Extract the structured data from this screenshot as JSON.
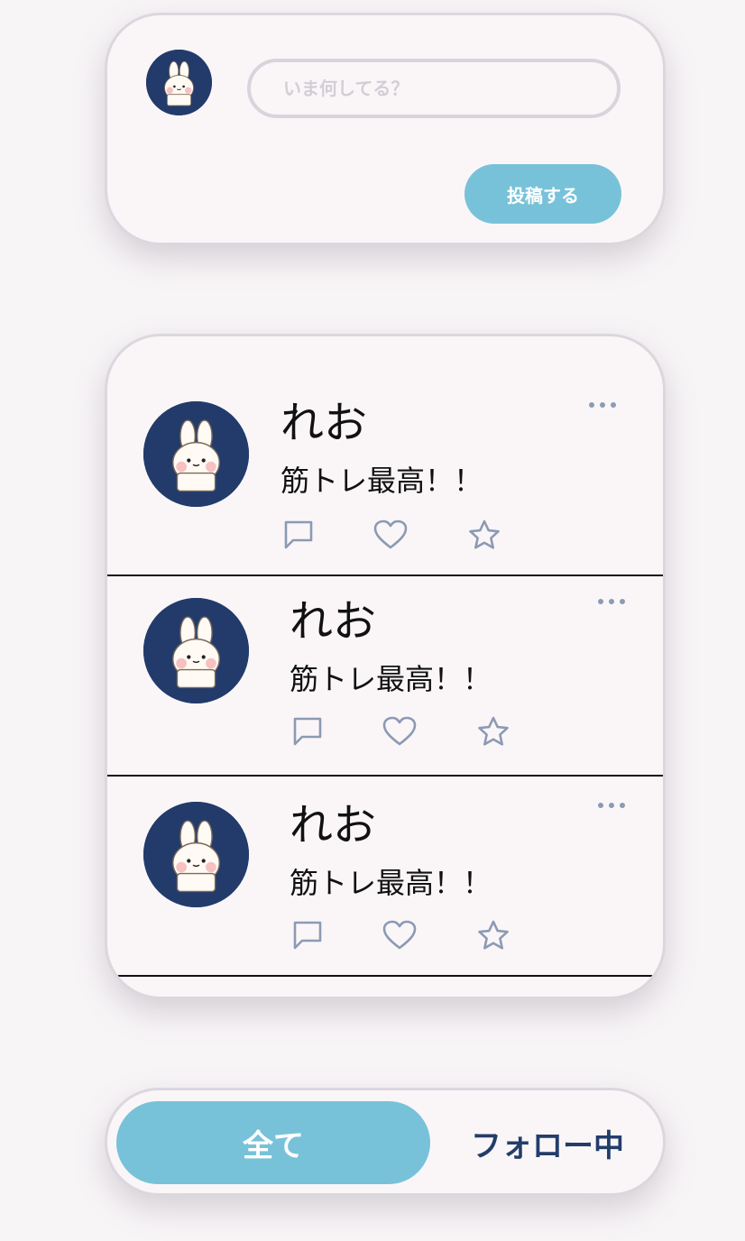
{
  "composer": {
    "placeholder": "いま何してる？",
    "value": "",
    "post_button_label": "投稿する"
  },
  "feed": {
    "posts": [
      {
        "username": "れお",
        "content": "筋トレ最高！！"
      },
      {
        "username": "れお",
        "content": "筋トレ最高！！"
      },
      {
        "username": "れお",
        "content": "筋トレ最高！！"
      }
    ]
  },
  "tabs": {
    "all_label": "全て",
    "following_label": "フォロー中",
    "selected": "all"
  },
  "icons": {
    "avatar": "bunny-avatar-icon",
    "more": "more-dots-icon",
    "comment": "comment-icon",
    "like": "heart-icon",
    "favorite": "star-icon"
  },
  "colors": {
    "accent": "#78c2d9",
    "navy": "#223b6b",
    "action_icon": "#8c9ab3",
    "background": "#f8f5f7"
  }
}
